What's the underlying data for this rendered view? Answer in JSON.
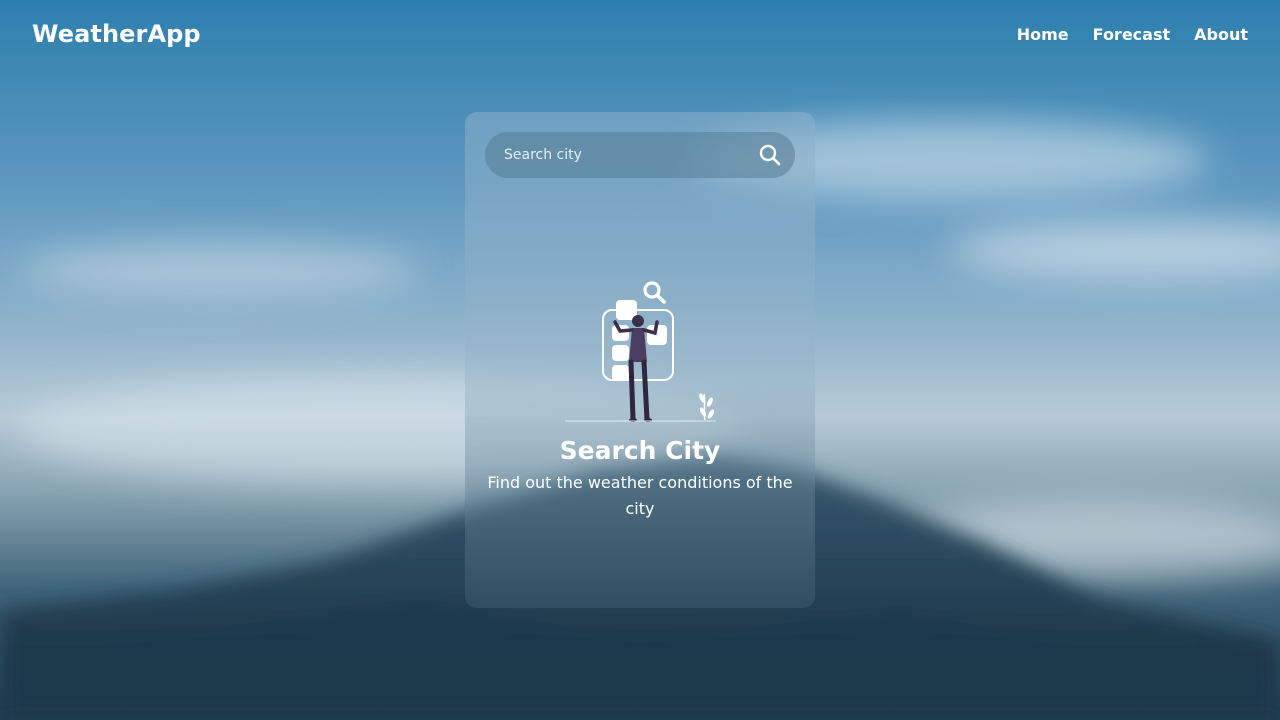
{
  "app": {
    "brand": "WeatherApp"
  },
  "nav": {
    "items": [
      {
        "label": "Home"
      },
      {
        "label": "Forecast"
      },
      {
        "label": "About"
      }
    ]
  },
  "search": {
    "placeholder": "Search city",
    "value": "",
    "icon": "search-icon"
  },
  "empty_state": {
    "illustration": "person-searching-illustration",
    "title": "Search City",
    "subtitle": "Find out the weather conditions of the city"
  },
  "colors": {
    "text": "#ffffff",
    "sky_top": "#2c7fae",
    "mountain_dark": "#1f3e52"
  }
}
